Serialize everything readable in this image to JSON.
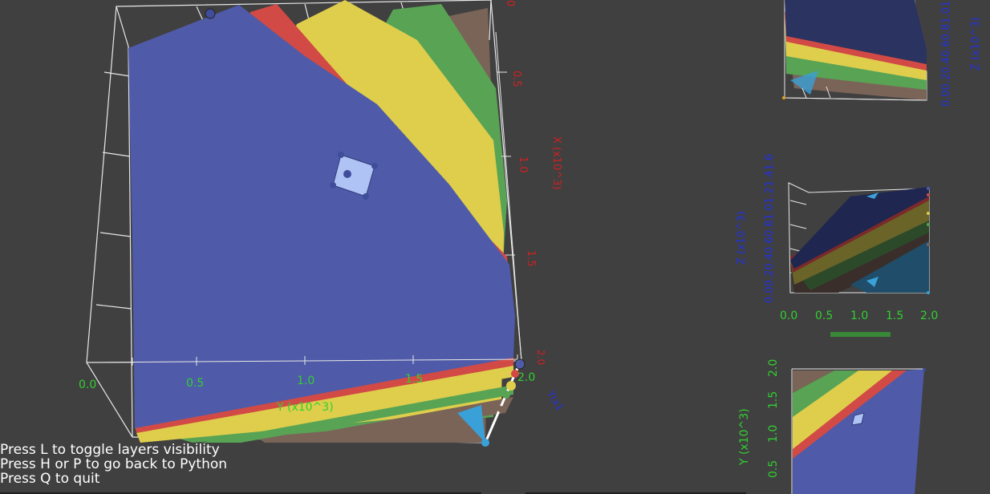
{
  "main_view": {
    "y_axis_title": "Y (x10^3)",
    "y_ticks": [
      "0.0",
      "0.5",
      "1.0",
      "1.5",
      "2.0"
    ],
    "x_axis_title": "X (x10^3)",
    "x_ticks": [
      "0.5",
      "1.0",
      "1.5"
    ],
    "partial_label_bottom": "Y(x1",
    "partial_label_top": "0",
    "partial_label_corner": "2.0"
  },
  "top_right_view": {
    "z_ticks_stacked": "0.00.20.40.60.81.01.21",
    "z_axis_title": "Z (x10^3)"
  },
  "middle_right_view": {
    "z_ticks_stacked": "0.00.20.40.60.81.01.21.41.6",
    "z_axis_title": "Z (x10^3)",
    "x_ticks": [
      "0.0",
      "0.5",
      "1.0",
      "1.5",
      "2.0"
    ]
  },
  "bottom_right_view": {
    "y_axis_title": "Y (x10^3)",
    "y_ticks": [
      "2.0",
      "1.5",
      "1.0",
      "0.5"
    ]
  },
  "help_lines": [
    "Press L to toggle layers visibility",
    "Press H or P to go back to Python",
    "Press Q to quit"
  ],
  "colors": {
    "background": "#404040",
    "layer_blue": "#4F5BA8",
    "layer_red": "#D24A45",
    "layer_yellow": "#DFCE4C",
    "layer_green": "#59A355",
    "layer_brown": "#7A6457",
    "axis_green": "#30D030",
    "axis_red": "#D02020",
    "axis_blue": "#2030E0"
  },
  "icons": [
    "control-point-icon",
    "selection-handle-icon"
  ]
}
